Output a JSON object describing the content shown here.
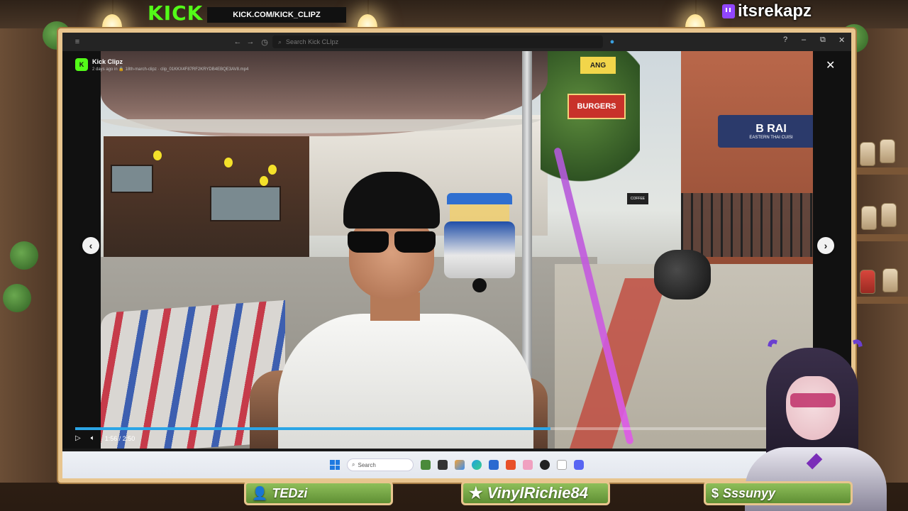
{
  "overlay": {
    "kick_logo": "KICK",
    "kick_url": "KICK.COM/KICK_CLIPZ",
    "twitch_handle": "itsrekapz"
  },
  "browser": {
    "search_placeholder": "Search Kick CLIpz",
    "window_controls": [
      "?",
      "–",
      "⧉",
      "✕"
    ]
  },
  "app": {
    "avatar_text": "K",
    "name": "Kick Clipz",
    "subtitle": "2 days ago in 🔒 18th-march-clipz · clip_01KKX4F87RF2KRYDB4EBQE3AV8.mp4"
  },
  "video": {
    "scene_signs": {
      "burgers": "BURGERS",
      "bar_name": "B RAI",
      "bar_sub": "EASTERN THAI CUISI",
      "ang": "ANG",
      "coffee": "COFFEE"
    },
    "time": "1:56 / 2:50",
    "progress_fraction": 0.67
  },
  "taskbar": {
    "search_label": "Search",
    "apps": [
      "file-explorer",
      "copilot",
      "edge",
      "store",
      "brave",
      "app-pink",
      "app-dark",
      "notepad",
      "discord"
    ]
  },
  "plates": [
    {
      "icon": "person-icon",
      "glyph": "👤",
      "name": "TEDzi"
    },
    {
      "icon": "star-icon",
      "glyph": "★",
      "name": "VinylRichie84"
    },
    {
      "icon": "dollar-icon",
      "glyph": "$",
      "name": "Sssunyy"
    }
  ],
  "colors": {
    "kick_green": "#53fc18",
    "progress_blue": "#2ba5e6",
    "frame_gold": "#e8c58e",
    "plate_green": "#7aa947",
    "twitch_purple": "#9146ff"
  }
}
